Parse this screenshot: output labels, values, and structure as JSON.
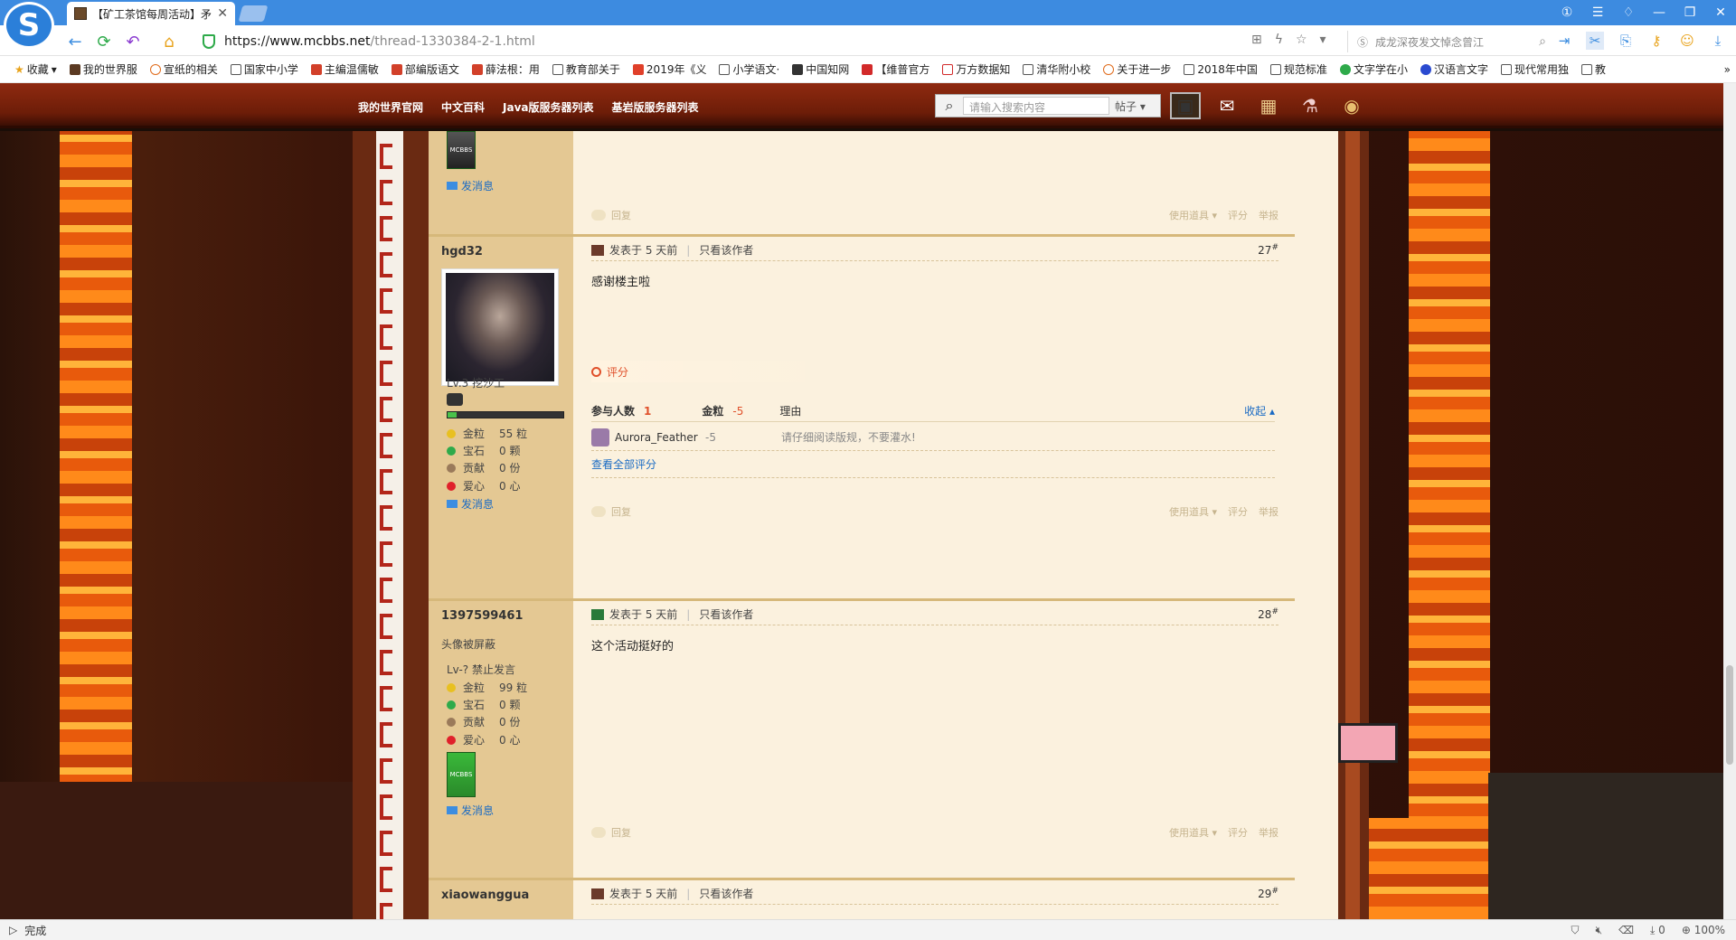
{
  "browser": {
    "tab_title": "【矿工茶馆每周活动】矛",
    "url_scheme": "https://",
    "url_host": "www.mcbbs.net",
    "url_path": "/thread-1330384-2-1.html",
    "search_placeholder": "成龙深夜发文悼念曾江",
    "status": "完成",
    "zoom": "100%",
    "download_count": "0",
    "bookmarks": [
      "收藏",
      "我的世界服",
      "宣纸的相关",
      "国家中小学",
      "主编温儒敏",
      "部编版语文",
      "薛法根：用",
      "教育部关于",
      "2019年《义",
      "小学语文·",
      "中国知网",
      "【维普官方",
      "万方数据知",
      "清华附小校",
      "关于进一步",
      "2018年中国",
      "规范标准",
      "文字学在小",
      "汉语言文字",
      "现代常用独",
      "教"
    ]
  },
  "site": {
    "nav": [
      "我的世界官网",
      "中文百科",
      "Java版服务器列表",
      "基岩版服务器列表"
    ],
    "search_placeholder": "请输入搜索内容",
    "search_type": "帖子"
  },
  "labels": {
    "send_message": "发消息",
    "reply": "回复",
    "use_tool": "使用道具",
    "rate": "评分",
    "report": "举报",
    "posted_at": "发表于 5 天前",
    "only_author": "只看该作者",
    "gold": "金粒",
    "gem": "宝石",
    "contrib": "贡献",
    "love": "爱心"
  },
  "posts": [
    {
      "floor": "27",
      "author": "hgd32",
      "level": "Lv.3 挖沙工",
      "stats": [
        "55 粒",
        "0 颗",
        "0 份",
        "0 心"
      ],
      "content": "感谢楼主啦",
      "rating": {
        "title": "评分",
        "participants_label": "参与人数",
        "participants": "1",
        "gold_label": "金粒",
        "gold_total": "-5",
        "reason_label": "理由",
        "collapse": "收起",
        "rows": [
          {
            "user": "Aurora_Feather",
            "value": "-5",
            "reason": "请仔细阅读版规，不要灌水!"
          }
        ],
        "view_all": "查看全部评分"
      }
    },
    {
      "floor": "28",
      "author": "1397599461",
      "avatar_note": "头像被屏蔽",
      "level": "Lv-? 禁止发言",
      "stats": [
        "99 粒",
        "0 颗",
        "0 份",
        "0 心"
      ],
      "content": "这个活动挺好的"
    },
    {
      "floor": "29",
      "author": "xiaowanggua"
    }
  ]
}
